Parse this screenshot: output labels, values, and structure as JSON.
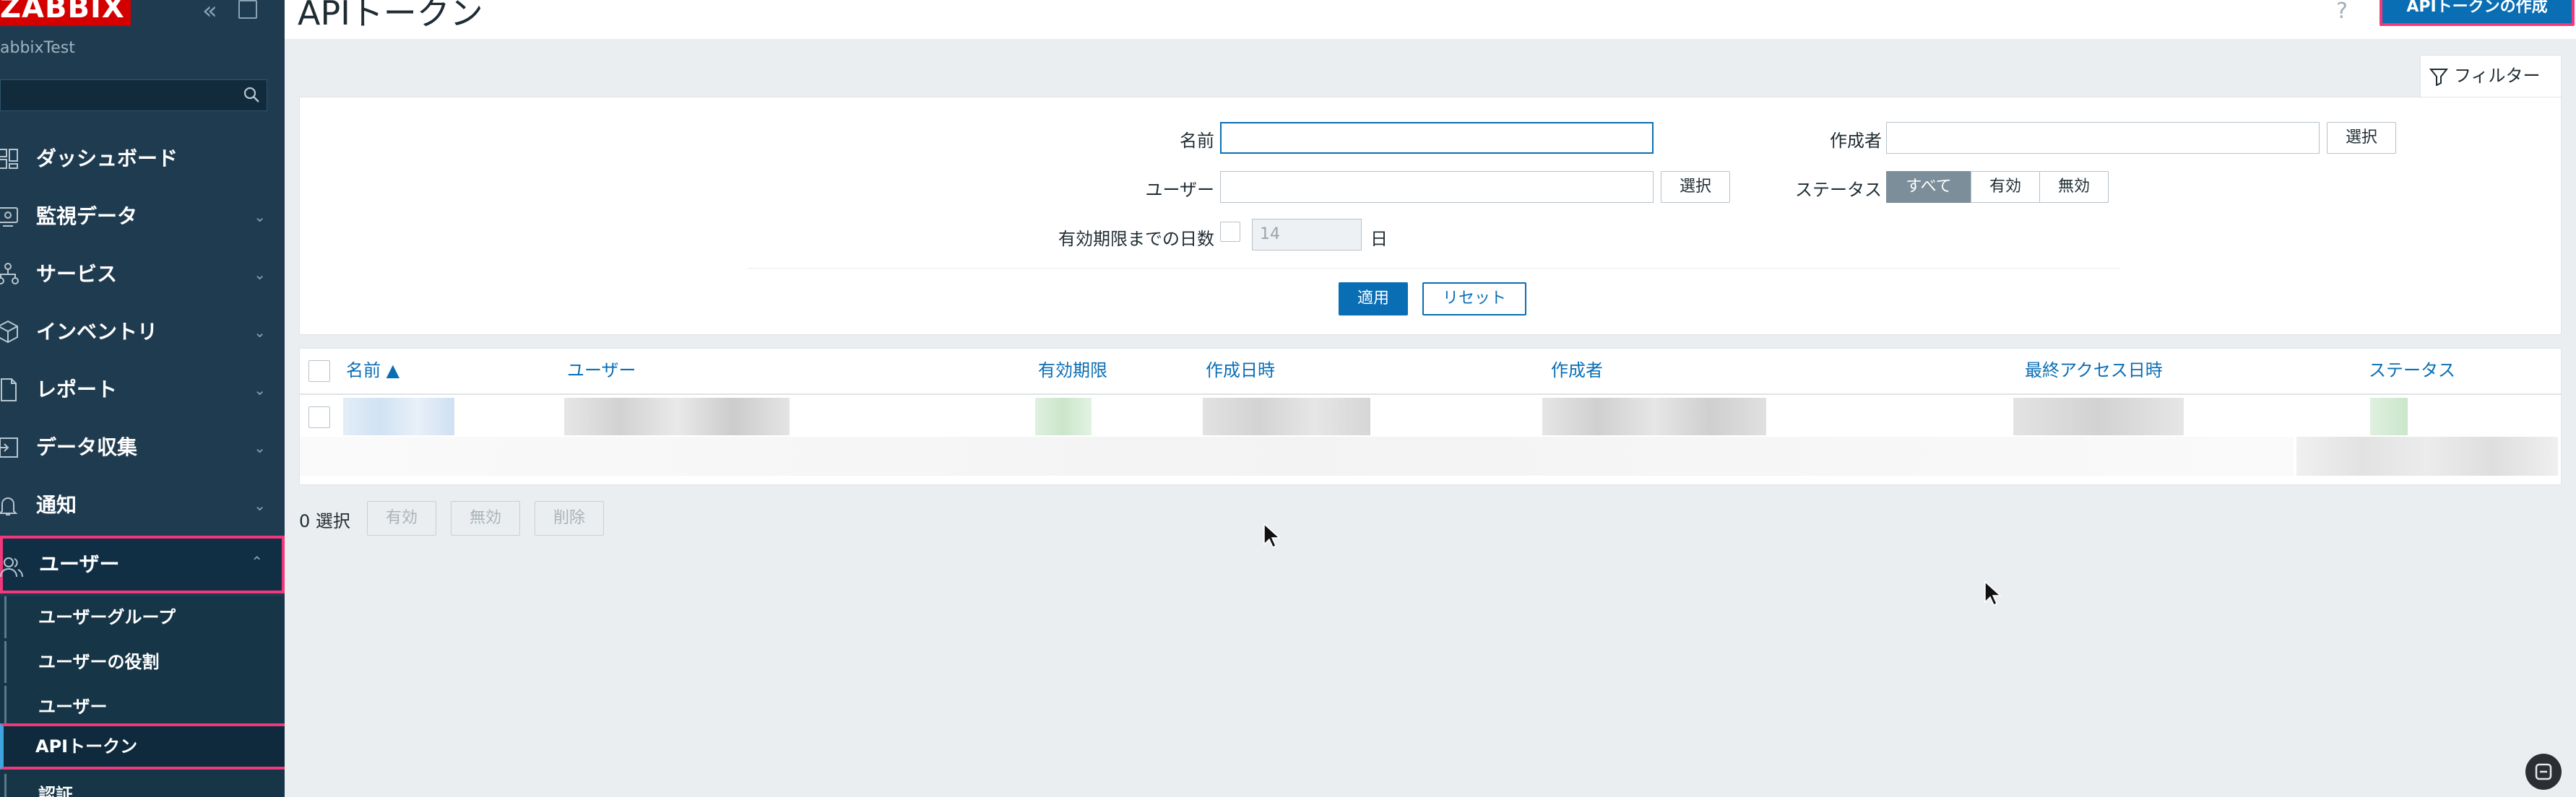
{
  "app": {
    "logo_text": "ZABBIX",
    "server_name": "abbixTest",
    "brand_color": "#d40000",
    "highlight_color": "#f0397b"
  },
  "sidebar": {
    "search_placeholder": "",
    "items": [
      {
        "label": "ダッシュボード",
        "icon": "dashboard-icon",
        "has_chevron": false
      },
      {
        "label": "監視データ",
        "icon": "monitoring-icon",
        "has_chevron": true
      },
      {
        "label": "サービス",
        "icon": "services-icon",
        "has_chevron": true
      },
      {
        "label": "インベントリ",
        "icon": "inventory-icon",
        "has_chevron": true
      },
      {
        "label": "レポート",
        "icon": "reports-icon",
        "has_chevron": true
      },
      {
        "label": "データ収集",
        "icon": "data-collection-icon",
        "has_chevron": true
      },
      {
        "label": "通知",
        "icon": "bell-icon",
        "has_chevron": true
      },
      {
        "label": "ユーザー",
        "icon": "users-icon",
        "has_chevron": true,
        "expanded": true
      }
    ],
    "submenu": [
      {
        "label": "ユーザーグループ"
      },
      {
        "label": "ユーザーの役割"
      },
      {
        "label": "ユーザー"
      },
      {
        "label": "APIトークン",
        "active": true
      },
      {
        "label": "認証"
      }
    ]
  },
  "header": {
    "title": "APIトークン",
    "help": "?",
    "create_button": "APIトークンの作成"
  },
  "filter": {
    "tab_label": "フィルター",
    "name_label": "名前",
    "name_value": "",
    "creator_label": "作成者",
    "creator_value": "",
    "creator_select": "選択",
    "user_label": "ユーザー",
    "user_value": "",
    "user_select": "選択",
    "status_label": "ステータス",
    "status_options": [
      "すべて",
      "有効",
      "無効"
    ],
    "status_selected": "すべて",
    "expiry_label": "有効期限までの日数",
    "expiry_checked": false,
    "expiry_days": "14",
    "expiry_unit": "日",
    "apply": "適用",
    "reset": "リセット"
  },
  "table": {
    "columns": [
      "名前 ▲",
      "ユーザー",
      "有効期限",
      "作成日時",
      "作成者",
      "最終アクセス日時",
      "ステータス"
    ],
    "rows": 1
  },
  "footer": {
    "selected_count": "0 選択",
    "actions": [
      "有効",
      "無効",
      "削除"
    ]
  }
}
